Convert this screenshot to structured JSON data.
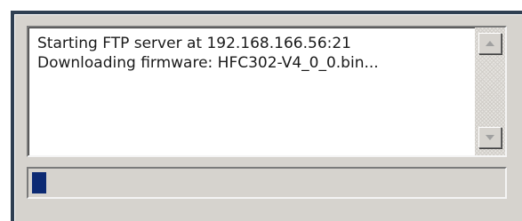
{
  "log": {
    "lines": [
      "Starting FTP server at 192.168.166.56:21",
      "Downloading firmware: HFC302-V4_0_0.bin..."
    ]
  },
  "scrollbar": {
    "up_icon": "scroll-up-arrow",
    "down_icon": "scroll-down-arrow"
  },
  "progress": {
    "fraction": 0.03,
    "fill_color": "#0c2a73"
  }
}
